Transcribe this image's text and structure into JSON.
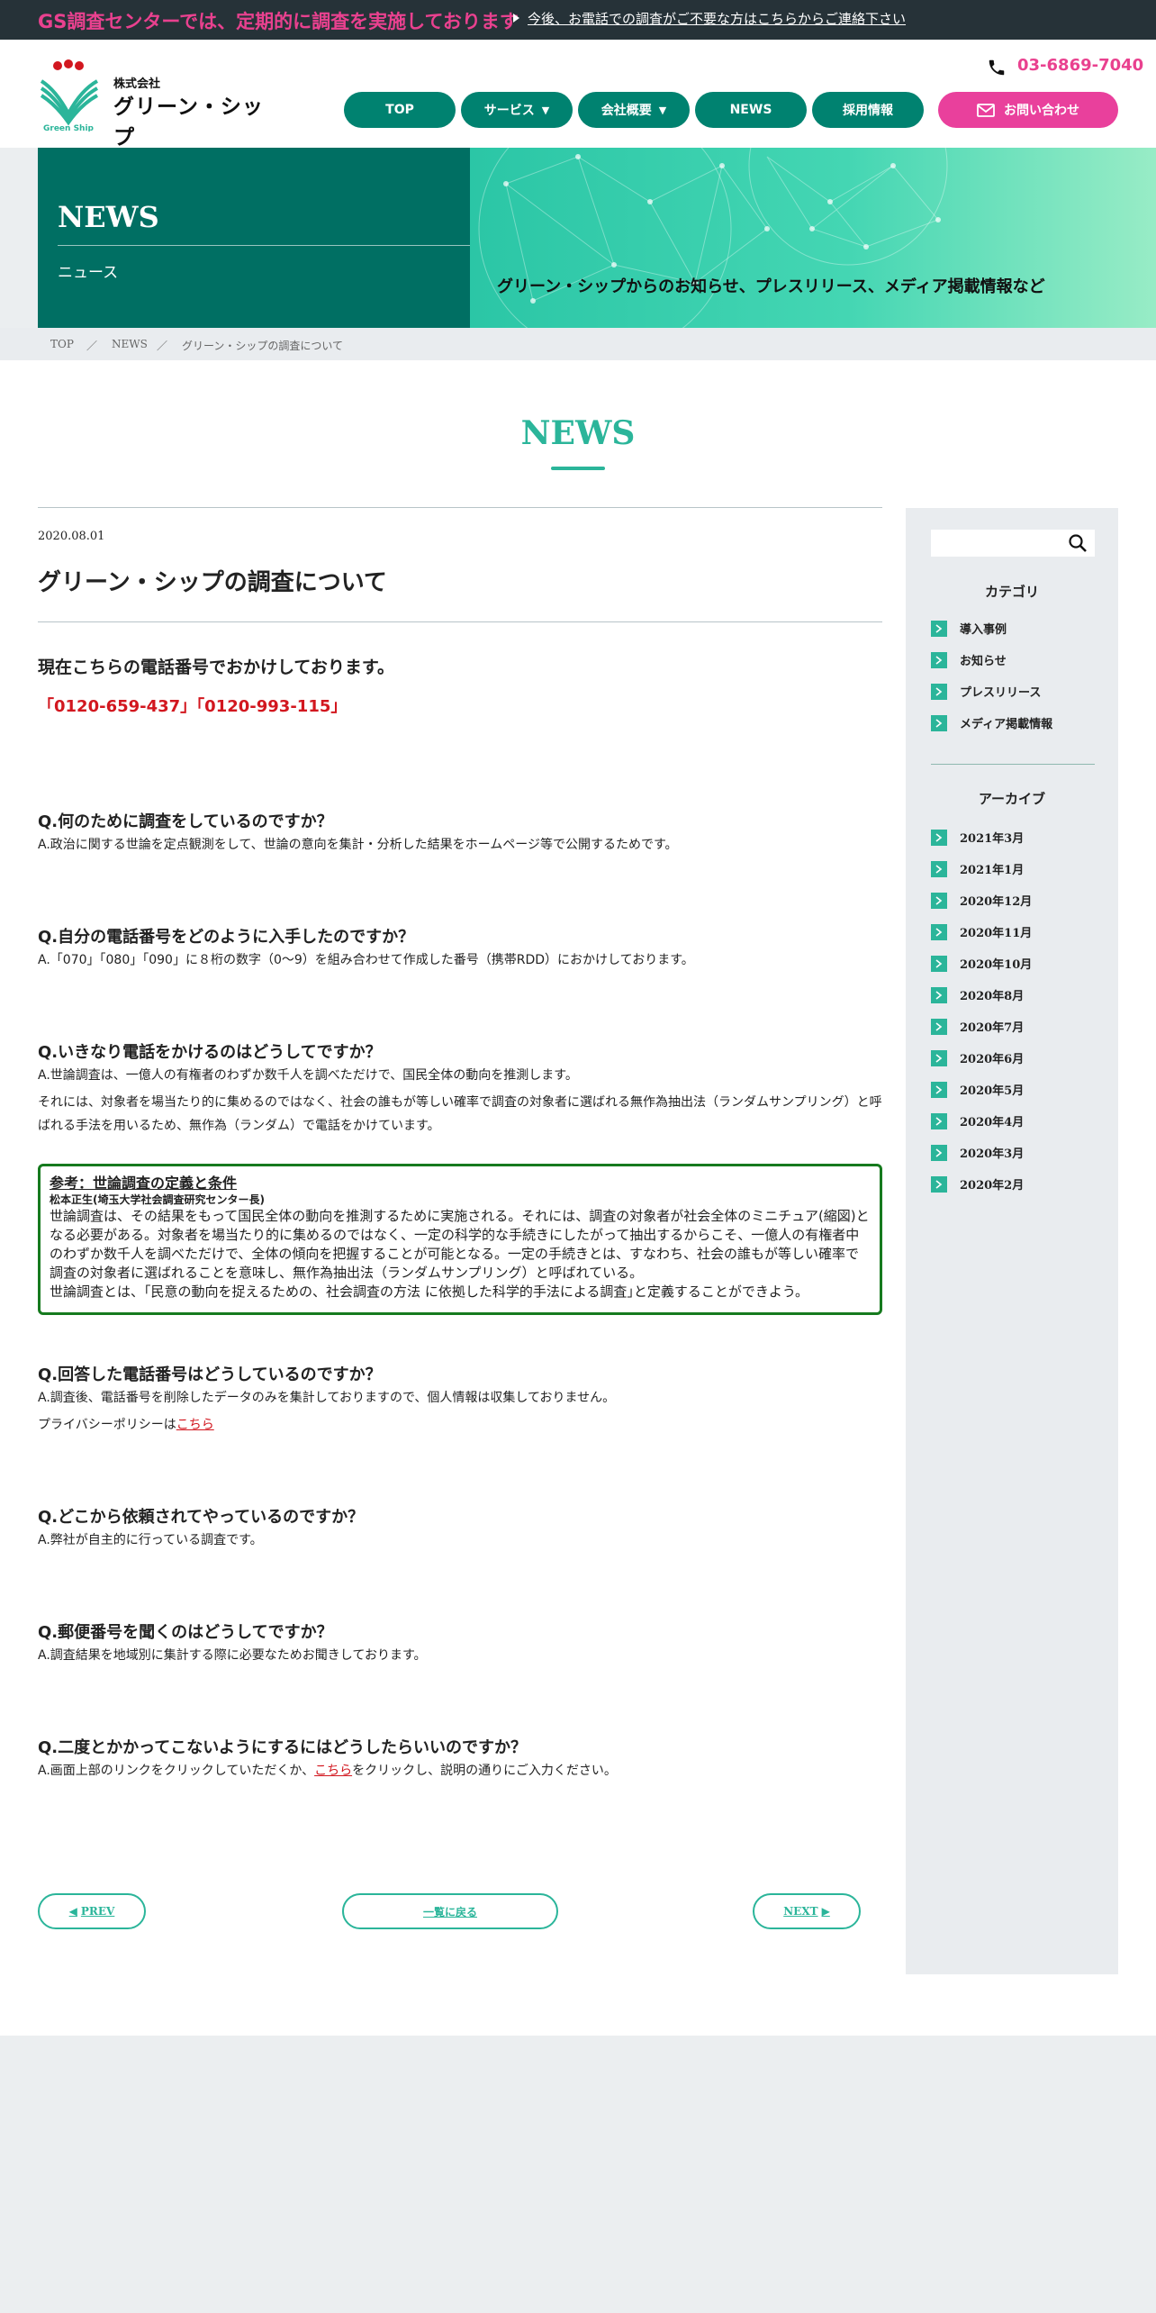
{
  "topbar": {
    "notice": "GS調査センターでは、定期的に調査を実施しております",
    "link": "今後、お電話での調査がご不要な方はこちらからご連絡下さい"
  },
  "header": {
    "logo": {
      "corp": "株式会社",
      "name": "グリーン・シップ",
      "en": "Green Ship"
    },
    "phone": "03-6869-7040",
    "nav": [
      {
        "label": "TOP"
      },
      {
        "label": "サービス"
      },
      {
        "label": "会社概要"
      },
      {
        "label": "NEWS"
      },
      {
        "label": "採用情報"
      }
    ],
    "contact": "お問い合わせ"
  },
  "hero": {
    "title_en": "NEWS",
    "title_ja": "ニュース",
    "description": "グリーン・シップからのお知らせ、プレスリリース、メディア掲載情報など"
  },
  "breadcrumb": [
    "TOP",
    "NEWS",
    "グリーン・シップの調査について"
  ],
  "breadcrumb_sep": "／",
  "page_title": "NEWS",
  "article": {
    "date": "2020.08.01",
    "title": "グリーン・シップの調査について",
    "lead": "現在こちらの電話番号でおかけしております。",
    "numbers": "「0120-659-437」「0120-993-115」",
    "faq": [
      {
        "q": "Q.何のために調査をしているのですか？",
        "a": "A.政治に関する世論を定点観測をして、世論の意向を集計・分析した結果をホームページ等で公開するためです。"
      },
      {
        "q": "Q.自分の電話番号をどのように入手したのですか？",
        "a": "A.「070」「080」「090」に８桁の数字（0～9）を組み合わせて作成した番号（携帯RDD）におかけしております。"
      },
      {
        "q": "Q.いきなり電話をかけるのはどうしてですか？",
        "a": "A.世論調査は、一億人の有権者のわずか数千人を調べただけで、国民全体の動向を推測します。",
        "a2": "それには、対象者を場当たり的に集めるのではなく、社会の誰もが等しい確率で調査の対象者に選ばれる無作為抽出法（ランダムサンプリング）と呼ばれる手法を用いるため、無作為（ランダム）で電話をかけています。"
      },
      {
        "q": "Q.回答した電話番号はどうしているのですか？",
        "a": "A.調査後、電話番号を削除したデータのみを集計しておりますので、個人情報は収集しておりません。",
        "a2_prefix": "プライバシーポリシーは",
        "a2_link": "こちら"
      },
      {
        "q": "Q.どこから依頼されてやっているのですか？",
        "a": "A.弊社が自主的に行っている調査です。"
      },
      {
        "q": "Q.郵便番号を聞くのはどうしてですか？",
        "a": "A.調査結果を地域別に集計する際に必要なためお聞きしております。"
      },
      {
        "q": "Q.二度とかかってこないようにするにはどうしたらいいのですか？",
        "a_prefix": "A.画面上部のリンクをクリックしていただくか、",
        "a_link": "こちら",
        "a_suffix": "をクリックし、説明の通りにご入力ください。"
      }
    ],
    "reference": {
      "title": "参考：世論調査の定義と条件",
      "source": "松本正生(埼玉大学社会調査研究センター長)",
      "body": "世論調査は、その結果をもって国民全体の動向を推測するために実施される。それには、調査の対象者が社会全体のミニチュア(縮図)となる必要がある。対象者を場当たり的に集めるのではなく、一定の科学的な手続きにしたがって抽出するからこそ、一億人の有権者中のわずか数千人を調べただけで、全体の傾向を把握することが可能となる。一定の手続きとは、すなわち、社会の誰もが等しい確率で調査の対象者に選ばれることを意味し、無作為抽出法（ランダムサンプリング）と呼ばれている。",
      "body2": "世論調査とは、｢民意の動向を捉えるための、社会調査の方法 に依拠した科学的手法による調査｣と定義することができよう。"
    }
  },
  "pagination": {
    "prev": "PREV",
    "list": "一覧に戻る",
    "next": "NEXT"
  },
  "sidebar": {
    "category_title": "カテゴリ",
    "categories": [
      "導入事例",
      "お知らせ",
      "プレスリリース",
      "メディア掲載情報"
    ],
    "archive_title": "アーカイブ",
    "archives": [
      "2021年3月",
      "2021年1月",
      "2020年12月",
      "2020年11月",
      "2020年10月",
      "2020年8月",
      "2020年7月",
      "2020年6月",
      "2020年5月",
      "2020年4月",
      "2020年3月",
      "2020年2月"
    ]
  },
  "colors": {
    "brand_green": "#008270",
    "accent_pink": "#e9418f",
    "teal": "#2bb59a",
    "red": "#d2171f"
  }
}
